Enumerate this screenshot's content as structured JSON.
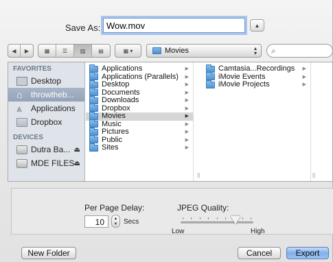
{
  "dialog": {
    "save_as_label": "Save As:",
    "filename_value": "Wow.mov"
  },
  "toolbar": {
    "location": "Movies",
    "search_placeholder": ""
  },
  "sidebar": {
    "sections": [
      {
        "header": "FAVORITES",
        "items": [
          {
            "label": "Desktop",
            "icon": "desktop-icon",
            "selected": false
          },
          {
            "label": "throwtheb...",
            "icon": "home-icon",
            "selected": true
          },
          {
            "label": "Applications",
            "icon": "applications-icon",
            "selected": false
          },
          {
            "label": "Dropbox",
            "icon": "folder-icon",
            "selected": false
          }
        ]
      },
      {
        "header": "DEVICES",
        "items": [
          {
            "label": "Dutra Ba...",
            "icon": "disk-icon",
            "eject": true
          },
          {
            "label": "MDE FILES",
            "icon": "disk-icon",
            "eject": true
          }
        ]
      }
    ]
  },
  "columns": {
    "col1": [
      {
        "label": "Applications",
        "selected": false
      },
      {
        "label": "Applications (Parallels)",
        "selected": false
      },
      {
        "label": "Desktop",
        "selected": false
      },
      {
        "label": "Documents",
        "selected": false
      },
      {
        "label": "Downloads",
        "selected": false
      },
      {
        "label": "Dropbox",
        "selected": false
      },
      {
        "label": "Movies",
        "selected": true
      },
      {
        "label": "Music",
        "selected": false
      },
      {
        "label": "Pictures",
        "selected": false
      },
      {
        "label": "Public",
        "selected": false
      },
      {
        "label": "Sites",
        "selected": false
      }
    ],
    "col2": [
      {
        "label": "Camtasia...Recordings"
      },
      {
        "label": "iMovie Events"
      },
      {
        "label": "iMovie Projects"
      }
    ]
  },
  "accessory": {
    "delay_label": "Per Page Delay:",
    "delay_value": "10",
    "delay_unit": "Secs",
    "quality_label": "JPEG Quality:",
    "quality_low": "Low",
    "quality_high": "High",
    "quality_level": 0.75
  },
  "buttons": {
    "new_folder": "New Folder",
    "cancel": "Cancel",
    "export": "Export"
  },
  "colors": {
    "selection": "#94a3b9",
    "focus_ring": "#6fa0e6",
    "default_button": "#7fb0ea"
  }
}
